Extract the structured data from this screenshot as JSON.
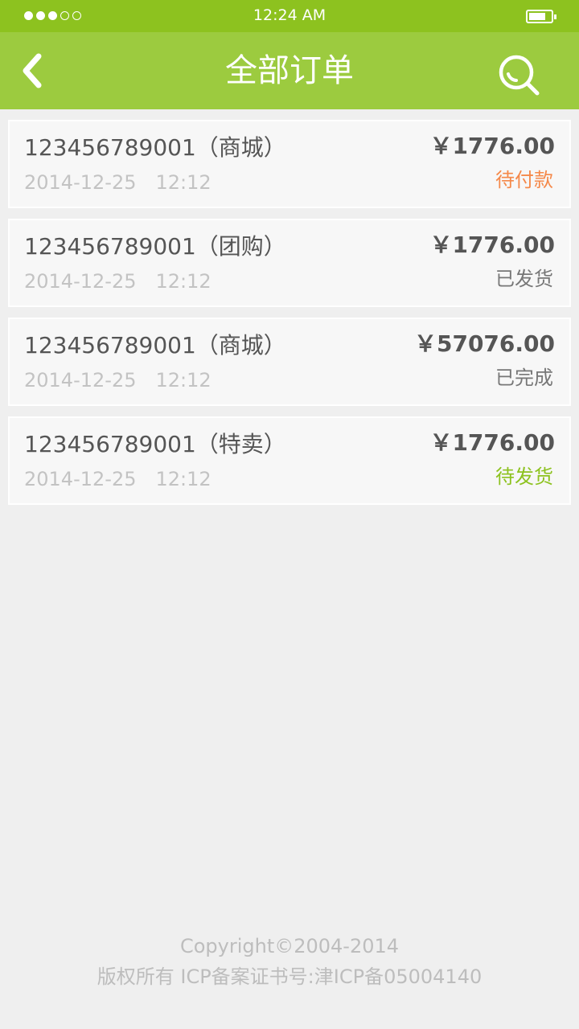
{
  "status_bar": {
    "time": "12:24 AM",
    "signal_bars": 5,
    "signal_filled": 3
  },
  "header": {
    "title": "全部订单",
    "back_icon": "chevron-left-icon",
    "search_icon": "search-icon"
  },
  "orders": [
    {
      "id_label": "123456789001（商城）",
      "date": "2014-12-25　12:12",
      "price": "￥1776.00",
      "status": "待付款",
      "status_color": "#f5894a"
    },
    {
      "id_label": "123456789001（团购）",
      "date": "2014-12-25　12:12",
      "price": "￥1776.00",
      "status": "已发货",
      "status_color": "#777777"
    },
    {
      "id_label": "123456789001（商城）",
      "date": "2014-12-25　12:12",
      "price": "￥57076.00",
      "status": "已完成",
      "status_color": "#777777"
    },
    {
      "id_label": "123456789001（特卖）",
      "date": "2014-12-25　12:12",
      "price": "￥1776.00",
      "status": "待发货",
      "status_color": "#8dc21f"
    }
  ],
  "footer": {
    "copyright": "Copyright©2004-2014",
    "icp": "版权所有 ICP备案证书号:津ICP备05004140"
  },
  "colors": {
    "status_bar_bg": "#8dc21f",
    "nav_bg": "#9ccb3f",
    "page_bg": "#efefef"
  }
}
